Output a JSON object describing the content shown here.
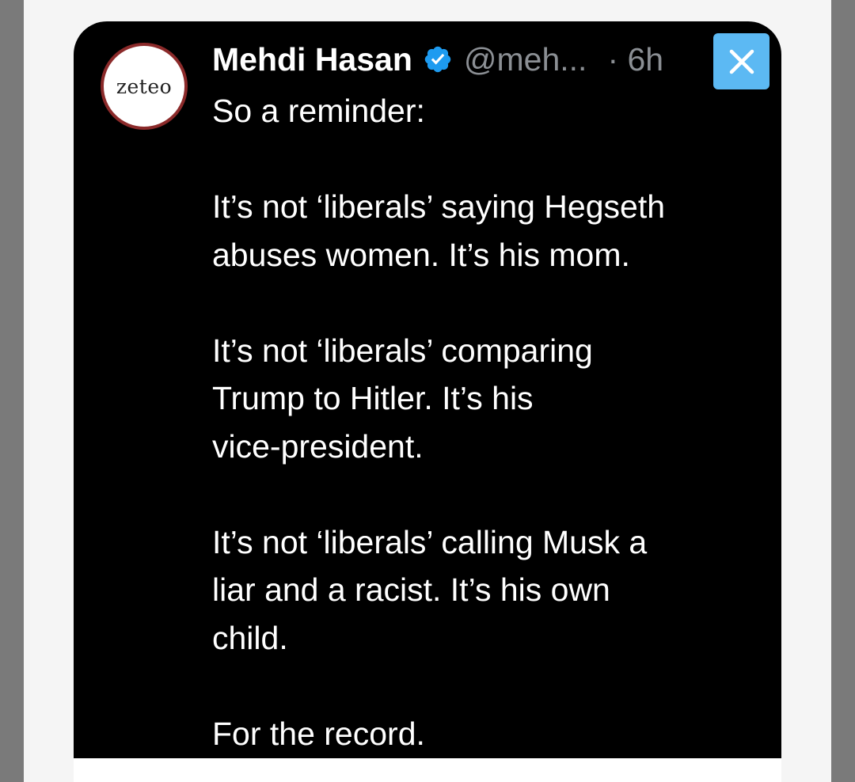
{
  "tweet": {
    "avatar_text": "zeteo",
    "author_name": "Mehdi Hasan",
    "handle": "@meh...",
    "time": "· 6h",
    "paragraphs": [
      "So a reminder:",
      "It’s not ‘liberals’ saying Hegseth\nabuses women. It’s his mom.",
      "It’s not ‘liberals’ comparing\nTrump to Hitler. It’s his\nvice-president.",
      "It’s not ‘liberals’ calling Musk a\nliar and a racist. It’s his own\nchild.",
      "For the record."
    ]
  },
  "icons": {
    "verified": "verified-badge-icon",
    "close": "close-icon"
  },
  "colors": {
    "card_background": "#000000",
    "verified_blue": "#1d9bf0",
    "close_button": "#5cb9f3",
    "muted_text": "#8b8f94",
    "avatar_ring": "#8b2a2a"
  }
}
